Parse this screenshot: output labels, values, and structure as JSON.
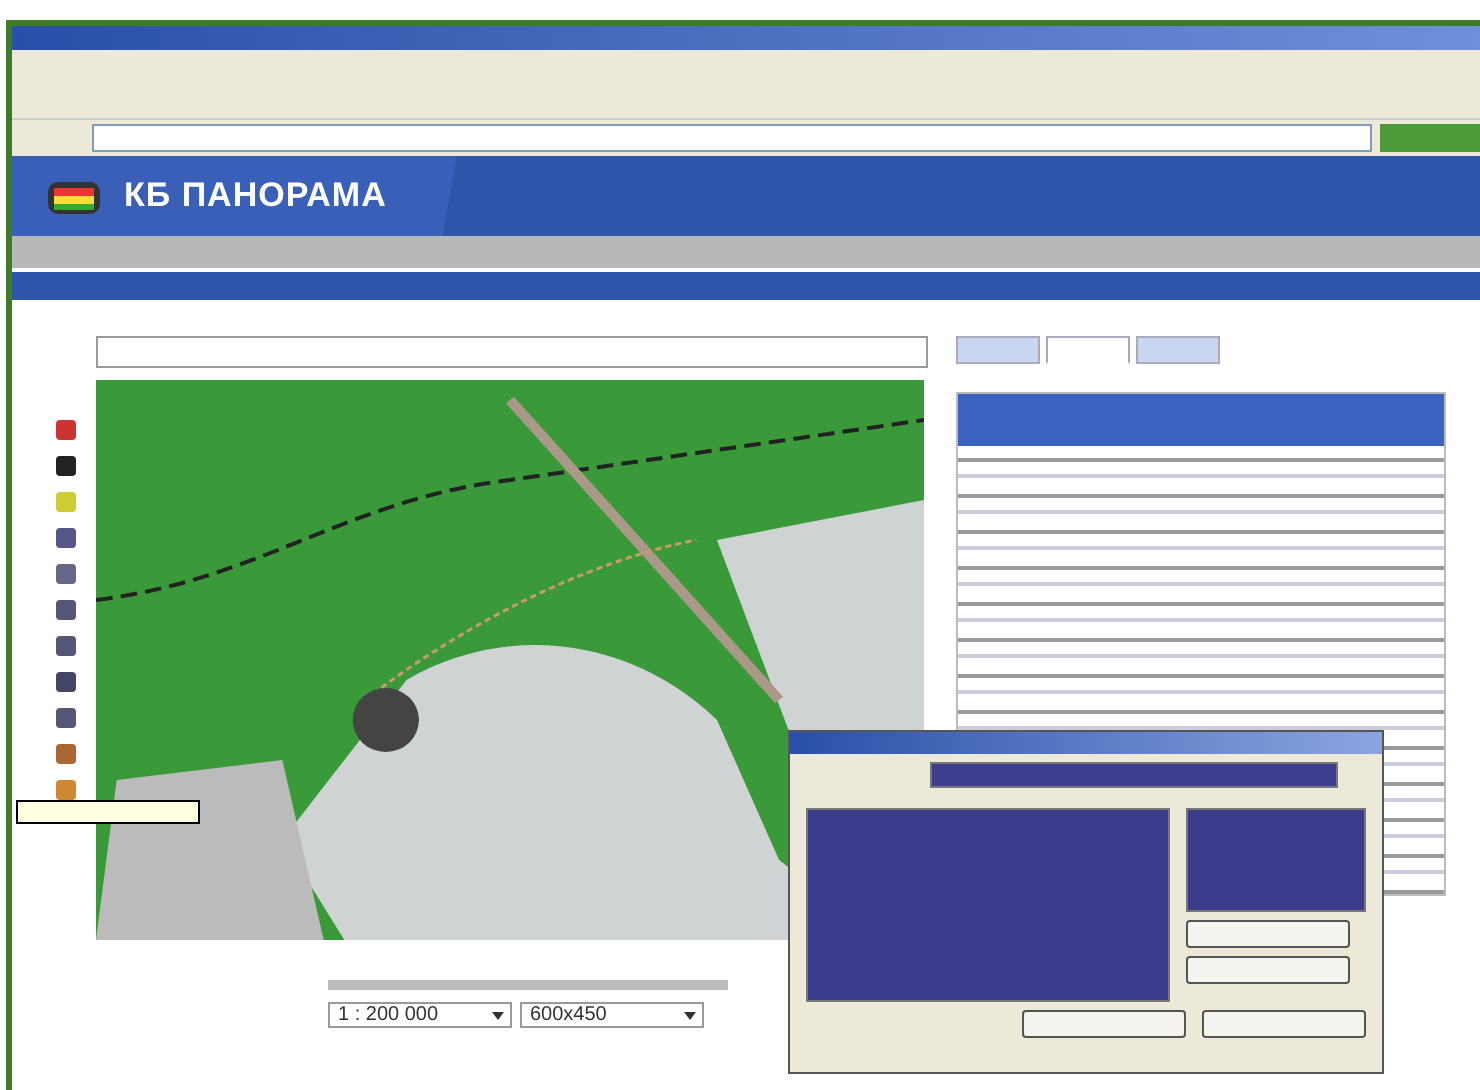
{
  "banner": {
    "title": "КБ ПАНОРАМА"
  },
  "tabs": [
    {
      "selected": false
    },
    {
      "selected": true
    },
    {
      "selected": false
    }
  ],
  "scale": {
    "value": "1 : 200 000"
  },
  "map_size": {
    "value": "600x450"
  }
}
